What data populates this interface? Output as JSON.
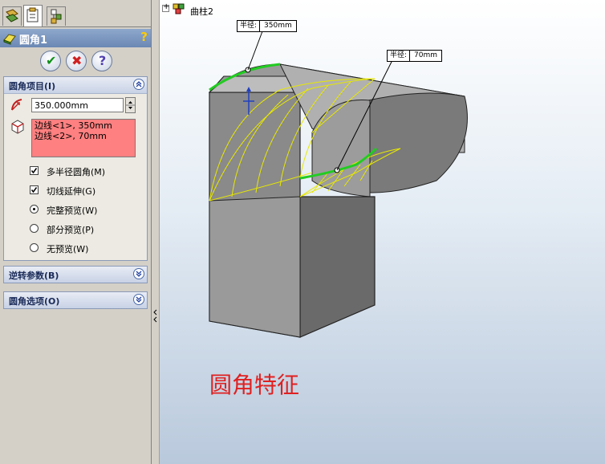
{
  "feature_panel": {
    "title": "圆角1",
    "actions": {
      "ok": "✔",
      "cancel": "✖",
      "help": "?"
    },
    "fillet_items": {
      "header": "圆角项目(I)",
      "radius_value": "350.000mm",
      "edges": [
        "边线<1>, 350mm",
        "边线<2>, 70mm"
      ],
      "options": {
        "multi_radius": "多半径圆角(M)",
        "tangent_propagation": "切线延伸(G)",
        "full_preview": "完整预览(W)",
        "partial_preview": "部分预览(P)",
        "no_preview": "无预览(W)"
      },
      "multi_radius_checked": true,
      "tangent_checked": true,
      "selected_preview": "full"
    },
    "setback_group": "逆转参数(B)",
    "options_group": "圆角选项(O)"
  },
  "feature_tree": {
    "expander": "+",
    "item": "曲柱2"
  },
  "callouts": [
    {
      "label": "半径:",
      "value": "350mm"
    },
    {
      "label": "半径:",
      "value": "70mm"
    }
  ],
  "caption": "圆角特征",
  "colors": {
    "edge_highlight": "#22cc22",
    "preview": "#e8e800",
    "caption": "#e02020",
    "edge_list_bg": "#ff8080"
  }
}
